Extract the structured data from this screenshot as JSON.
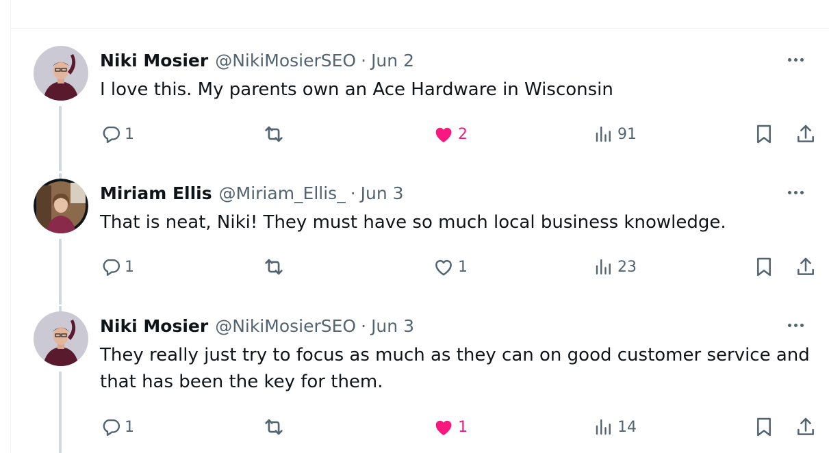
{
  "tweets": [
    {
      "name": "Niki Mosier",
      "handle": "@NikiMosierSEO",
      "separator": "·",
      "date": "Jun 2",
      "text": "I love this. My parents own an Ace Hardware in Wisconsin",
      "replies": "1",
      "retweets": "",
      "likes": "2",
      "liked": true,
      "views": "91"
    },
    {
      "name": "Miriam Ellis",
      "handle": "@Miriam_Ellis_",
      "separator": "·",
      "date": "Jun 3",
      "text": "That is neat, Niki! They must have so much local business knowledge.",
      "replies": "1",
      "retweets": "",
      "likes": "1",
      "liked": false,
      "views": "23"
    },
    {
      "name": "Niki Mosier",
      "handle": "@NikiMosierSEO",
      "separator": "·",
      "date": "Jun 3",
      "text": "They really just try to focus as much as they can on good customer service and that has been the key for them.",
      "replies": "1",
      "retweets": "",
      "likes": "1",
      "liked": true,
      "views": "14"
    }
  ],
  "icons": {
    "reply": "reply-icon",
    "retweet": "retweet-icon",
    "like": "heart-icon",
    "views": "analytics-icon",
    "bookmark": "bookmark-icon",
    "share": "share-icon",
    "more": "more-icon"
  },
  "colors": {
    "text": "#0f1419",
    "secondary": "#536471",
    "like": "#f91880",
    "thread_line": "#cfd9de"
  }
}
